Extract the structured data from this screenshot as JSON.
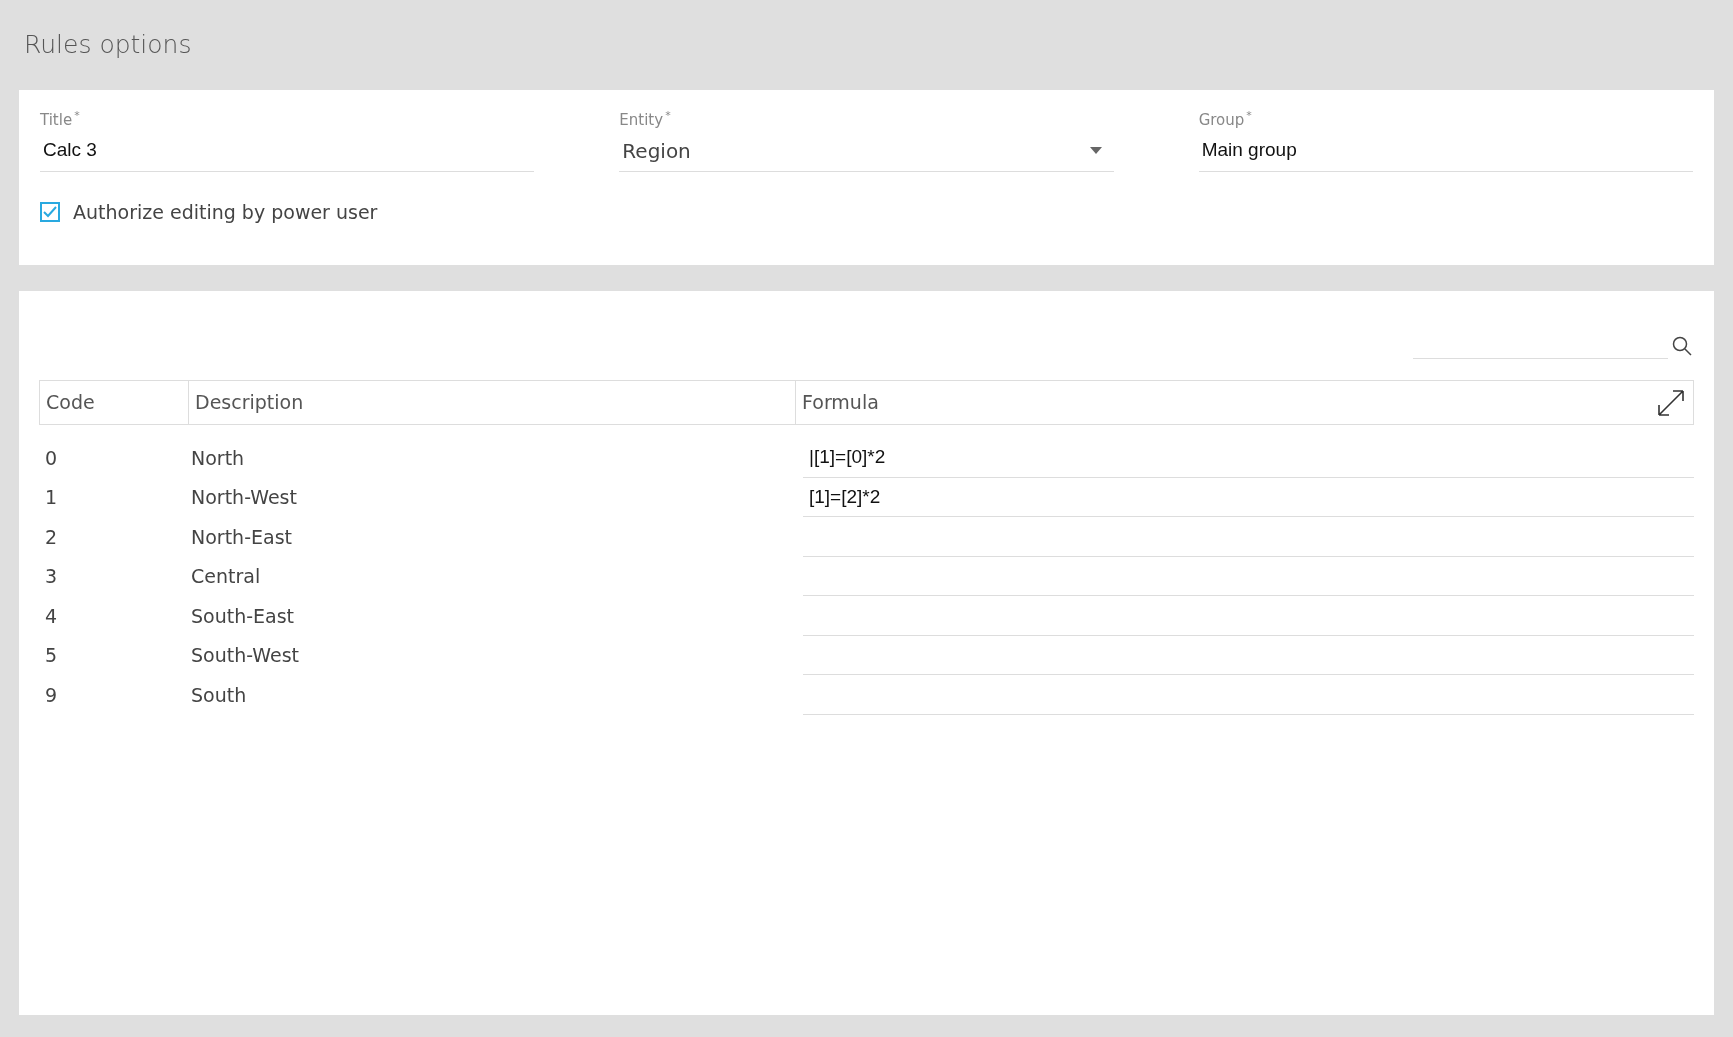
{
  "page_title": "Rules options",
  "fields": [
    {
      "kind": "text",
      "label": "Title",
      "required_mark": "*",
      "value": "Calc 3"
    },
    {
      "kind": "select",
      "label": "Entity",
      "required_mark": "*",
      "value": "Region"
    },
    {
      "kind": "text",
      "label": "Group",
      "required_mark": "*",
      "value": "Main group"
    }
  ],
  "checkbox": {
    "label": "Authorize editing by power user",
    "checked": true
  },
  "table": {
    "columns": [
      "Code",
      "Description",
      "Formula"
    ],
    "rows": [
      {
        "code": "0",
        "description": "North",
        "formula": "|[1]=[0]*2"
      },
      {
        "code": "1",
        "description": "North-West",
        "formula": "[1]=[2]*2"
      },
      {
        "code": "2",
        "description": "North-East",
        "formula": ""
      },
      {
        "code": "3",
        "description": "Central",
        "formula": ""
      },
      {
        "code": "4",
        "description": "South-East",
        "formula": ""
      },
      {
        "code": "5",
        "description": "South-West",
        "formula": ""
      },
      {
        "code": "9",
        "description": "South",
        "formula": ""
      }
    ]
  }
}
